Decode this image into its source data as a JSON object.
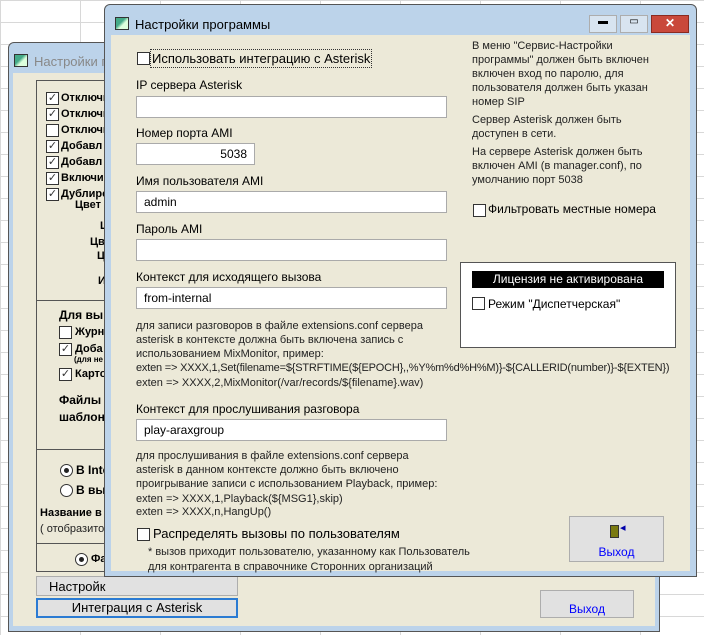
{
  "back_window": {
    "title": "Настройки п",
    "checkboxes": [
      {
        "label": "Отключи",
        "checked": true
      },
      {
        "label": "Отключи",
        "checked": true
      },
      {
        "label": "Отключи",
        "checked": false
      },
      {
        "label": "Добавл",
        "checked": true
      },
      {
        "label": "Добавл",
        "checked": true
      },
      {
        "label": "Включит",
        "checked": true
      },
      {
        "label": "Дублиро",
        "checked": true
      }
    ],
    "labels": [
      "Цвет",
      "Ц",
      "Цв",
      "Ц",
      "И"
    ],
    "section2_title": "Для вы",
    "section2_checkboxes": [
      {
        "label": "Журн",
        "checked": false
      },
      {
        "label": "Доба",
        "checked": true
      },
      {
        "label": "Карто",
        "checked": true
      }
    ],
    "section2_note": "(для не",
    "files_label_1": "Файлы",
    "files_label_2": "шаблон",
    "radios": [
      {
        "label": "В Inte",
        "checked": true
      },
      {
        "label": "В вы",
        "checked": false
      }
    ],
    "name_label": "Название в",
    "name_note": "( отобразито",
    "radio_bottom": {
      "label": "Фа",
      "checked": true
    },
    "settings_button": "Настройк",
    "asterisk_button": "Интеграция с Asterisk",
    "exit_button": "Выход"
  },
  "front_window": {
    "title": "Настройки программы",
    "use_integration": {
      "label": "Использовать интеграцию с Asterisk",
      "checked": false
    },
    "ip_label": "IP сервера Asterisk",
    "ip_value": "",
    "port_label": "Номер порта AMI",
    "port_value": "5038",
    "user_label": "Имя пользователя AMI",
    "user_value": "admin",
    "password_label": "Пароль AMI",
    "password_value": "",
    "out_context_label": "Контекст для исходящего вызова",
    "out_context_value": "from-internal",
    "out_help": [
      "для записи разговоров в файле extensions.conf сервера",
      "asterisk в контексте должна быть включена запись с",
      "использованием MixMonitor, пример:"
    ],
    "out_examples": [
      "exten =>  XXXX,1,Set(filename=${STRFTIME(${EPOCH},,%Y%m%d%H%M)}-${CALLERID(number)}-${EXTEN})",
      "exten =>  XXXX,2,MixMonitor(/var/records/${filename}.wav)"
    ],
    "listen_context_label": "Контекст для прослушивания разговора",
    "listen_context_value": "play-araxgroup",
    "listen_help": [
      "для прослушивания в файле extensions.conf сервера",
      "asterisk в данном контексте должно быть включено",
      "проигрывание записи с использованием Playback, пример:"
    ],
    "listen_examples": [
      "exten =>  XXXX,1,Playback(${MSG1},skip)",
      "exten =>  XXXX,n,HangUp()"
    ],
    "distribute": {
      "label": "Распределять вызовы по пользователям",
      "checked": false
    },
    "distribute_note": [
      "* вызов приходит пользователю, указанному как Пользователь",
      "для контрагента в справочнике Сторонних организаций"
    ],
    "info1": [
      "В меню \"Сервис-Настройки",
      "программы\" должен быть включен",
      "включен вход по паролю, для",
      "пользователя должен быть указан",
      "номер SIP"
    ],
    "info2": [
      "Сервер Asterisk должен быть",
      "доступен в сети."
    ],
    "info3": [
      "На сервере Asterisk должен быть",
      "включен AMI (в manager.conf), по",
      "умолчанию порт 5038"
    ],
    "filter_local": {
      "label": "Фильтровать местные номера",
      "checked": false
    },
    "license_status": "Лицензия не активирована",
    "dispatcher_mode": {
      "label": "Режим \"Диспетчерская\"",
      "checked": false
    },
    "exit_button": "Выход"
  }
}
